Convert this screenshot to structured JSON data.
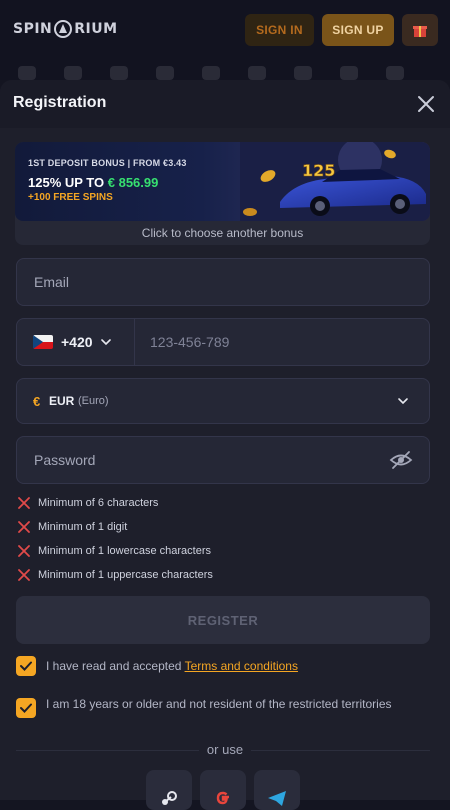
{
  "header": {
    "logo_text_left": "SPIN",
    "logo_text_right": "RIUM",
    "signin_label": "SIGN IN",
    "signup_label": "SIGN UP",
    "gift_icon": "gift-icon"
  },
  "modal": {
    "title": "Registration",
    "close_icon": "close-icon"
  },
  "bonus": {
    "line1": "1ST DEPOSIT BONUS | FROM €3.43",
    "percent_text": "125% UP TO",
    "amount": "€ 856.99",
    "spins": "+100 FREE SPINS",
    "badge": "125",
    "hint": "Click to choose another bonus"
  },
  "form": {
    "email_placeholder": "Email",
    "phone_prefix": "+420",
    "phone_placeholder": "123-456-789",
    "currency_symbol": "€",
    "currency_code": "EUR",
    "currency_name": "(Euro)",
    "password_placeholder": "Password"
  },
  "rules": [
    "Minimum of 6 characters",
    "Minimum of 1 digit",
    "Minimum of 1 lowercase characters",
    "Minimum of 1 uppercase characters"
  ],
  "register_label": "REGISTER",
  "agree": {
    "terms_prefix": "I have read and accepted ",
    "terms_link": "Terms and conditions",
    "age_text": "I am 18 years or older and not resident of the restricted territories"
  },
  "or_use": "or use",
  "colors": {
    "accent": "#f5a623",
    "bonus_amount": "#37e070",
    "error": "#e04a4a",
    "background": "#1e1f2b"
  }
}
